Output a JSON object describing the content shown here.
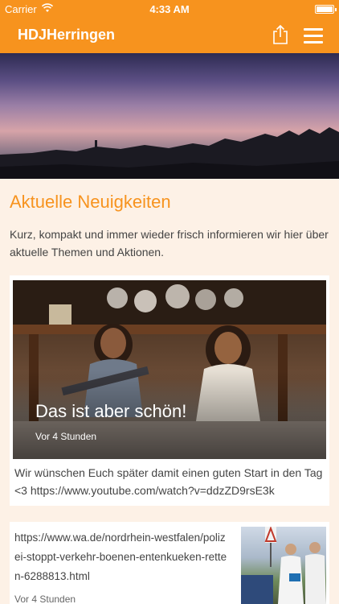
{
  "status": {
    "carrier": "Carrier",
    "time": "4:33 AM"
  },
  "navbar": {
    "title": "HDJHerringen"
  },
  "section": {
    "title": "Aktuelle Neuigkeiten",
    "description": "Kurz, kompakt und immer wieder frisch informieren wir hier über aktuelle Themen und Aktionen."
  },
  "posts": [
    {
      "title": "Das ist aber schön!",
      "time": "Vor 4 Stunden",
      "text": "Wir wünschen Euch später damit einen guten Start in den Tag <3 https://www.youtube.com/watch?v=ddzZD9rsE3k"
    },
    {
      "text": "https://www.wa.de/nordrhein-westfalen/polizei-stoppt-verkehr-boenen-entenkueken-retten-6288813.html",
      "time": "Vor 4 Stunden"
    }
  ],
  "icons": {
    "share": "share-icon",
    "menu": "menu-icon",
    "wifi": "wifi-icon",
    "battery": "battery-icon"
  },
  "colors": {
    "accent": "#f7931e",
    "background": "#fdf1e6",
    "title": "#f7931e",
    "text": "#444444"
  }
}
